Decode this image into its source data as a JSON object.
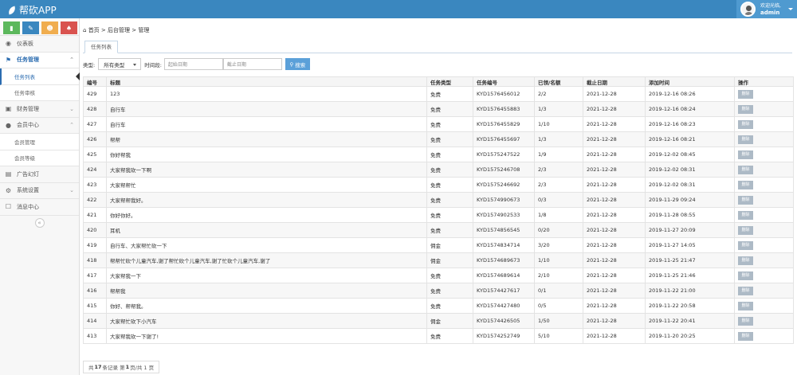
{
  "app": {
    "title": "帮砍APP"
  },
  "user": {
    "greeting": "欢迎光临,",
    "name": "admin"
  },
  "shortcuts": [
    {
      "icon": "chart-icon",
      "color": "#5cb85c"
    },
    {
      "icon": "pencil-icon",
      "color": "#3a87bf"
    },
    {
      "icon": "users-icon",
      "color": "#f0ad4e"
    },
    {
      "icon": "bell-icon",
      "color": "#d9534f"
    }
  ],
  "sidebar": {
    "items": [
      {
        "label": "仪表板",
        "icon": "dashboard-icon"
      },
      {
        "label": "任务管理",
        "icon": "flag-icon",
        "children": [
          {
            "label": "任务列表"
          },
          {
            "label": "任务审核"
          }
        ]
      },
      {
        "label": "财务管理",
        "icon": "wallet-icon"
      },
      {
        "label": "会员中心",
        "icon": "user-icon",
        "children": [
          {
            "label": "会员管理"
          },
          {
            "label": "会员等级"
          }
        ]
      },
      {
        "label": "广告幻灯",
        "icon": "image-icon"
      },
      {
        "label": "系统设置",
        "icon": "gear-icon"
      },
      {
        "label": "消息中心",
        "icon": "bookmark-icon"
      }
    ]
  },
  "breadcrumb": {
    "home": "首页",
    "sep": ">",
    "level1": "后台管理",
    "level2": "管理"
  },
  "tabs": [
    {
      "label": "任务列表"
    }
  ],
  "filters": {
    "type_label": "类型:",
    "type_value": "所有类型",
    "time_label": "时间段:",
    "start_placeholder": "起始日期",
    "end_placeholder": "截止日期",
    "search_label": "搜索"
  },
  "table": {
    "columns": [
      "编号",
      "标题",
      "任务类型",
      "任务编号",
      "已领/名额",
      "截止日期",
      "添加时间",
      "操作"
    ],
    "action_label": "删除",
    "rows": [
      [
        "429",
        "123",
        "免费",
        "KYD1576456012",
        "2/2",
        "2021-12-28",
        "2019-12-16 08:26"
      ],
      [
        "428",
        "自行车",
        "免费",
        "KYD1576455883",
        "1/3",
        "2021-12-28",
        "2019-12-16 08:24"
      ],
      [
        "427",
        "自行车",
        "免费",
        "KYD1576455829",
        "1/10",
        "2021-12-28",
        "2019-12-16 08:23"
      ],
      [
        "426",
        "帮帮",
        "免费",
        "KYD1576455697",
        "1/3",
        "2021-12-28",
        "2019-12-16 08:21"
      ],
      [
        "425",
        "你好帮我",
        "免费",
        "KYD1575247522",
        "1/9",
        "2021-12-28",
        "2019-12-02 08:45"
      ],
      [
        "424",
        "大家帮我砍一下啊",
        "免费",
        "KYD1575246708",
        "2/3",
        "2021-12-28",
        "2019-12-02 08:31"
      ],
      [
        "423",
        "大家帮帮忙",
        "免费",
        "KYD1575246692",
        "2/3",
        "2021-12-28",
        "2019-12-02 08:31"
      ],
      [
        "422",
        "大家帮帮我好。",
        "免费",
        "KYD1574990673",
        "0/3",
        "2021-12-28",
        "2019-11-29 09:24"
      ],
      [
        "421",
        "你好你好。",
        "免费",
        "KYD1574902533",
        "1/8",
        "2021-12-28",
        "2019-11-28 08:55"
      ],
      [
        "420",
        "耳机",
        "免费",
        "KYD1574856545",
        "0/20",
        "2021-12-28",
        "2019-11-27 20:09"
      ],
      [
        "419",
        "自行车、大家帮忙砍一下",
        "佣金",
        "KYD1574834714",
        "3/20",
        "2021-12-28",
        "2019-11-27 14:05"
      ],
      [
        "418",
        "帮帮忙砍个儿童汽车,谢了帮忙砍个儿童汽车,谢了忙砍个儿童汽车,谢了",
        "佣金",
        "KYD1574689673",
        "1/10",
        "2021-12-28",
        "2019-11-25 21:47"
      ],
      [
        "417",
        "大家帮我一下",
        "免费",
        "KYD1574689614",
        "2/10",
        "2021-12-28",
        "2019-11-25 21:46"
      ],
      [
        "416",
        "帮帮我",
        "免费",
        "KYD1574427617",
        "0/1",
        "2021-12-28",
        "2019-11-22 21:00"
      ],
      [
        "415",
        "你好、帮帮我。",
        "免费",
        "KYD1574427480",
        "0/5",
        "2021-12-28",
        "2019-11-22 20:58"
      ],
      [
        "414",
        "大家帮忙砍下小汽车",
        "佣金",
        "KYD1574426505",
        "1/50",
        "2021-12-28",
        "2019-11-22 20:41"
      ],
      [
        "413",
        "大家帮我砍一下谢了!",
        "免费",
        "KYD1574252749",
        "5/10",
        "2021-12-28",
        "2019-11-20 20:25"
      ]
    ]
  },
  "pager": {
    "prefix": "共",
    "total": "17",
    "mid": "条记录 第",
    "page": "1",
    "suffix": "页/共 1 页"
  }
}
